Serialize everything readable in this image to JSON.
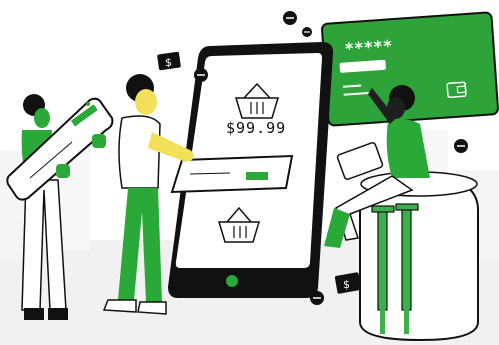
{
  "illustration": {
    "price_label": "$99.99",
    "card_masked_number": "*****",
    "banknote_symbol": "$",
    "colors": {
      "accent_green": "#2aa838",
      "card_green": "#2ea33a",
      "ink": "#111111",
      "skin_dark": "#1f1f1f",
      "skin_yellow": "#f2e05a",
      "crutch_green": "#3cb04a",
      "background_haze": "#d8d8d8"
    },
    "icons": [
      "shopping-basket-icon",
      "wallet-icon",
      "banknote-icon",
      "minus-coin-icon",
      "crutches-icon",
      "smartphone-icon",
      "credit-card-icon"
    ]
  }
}
